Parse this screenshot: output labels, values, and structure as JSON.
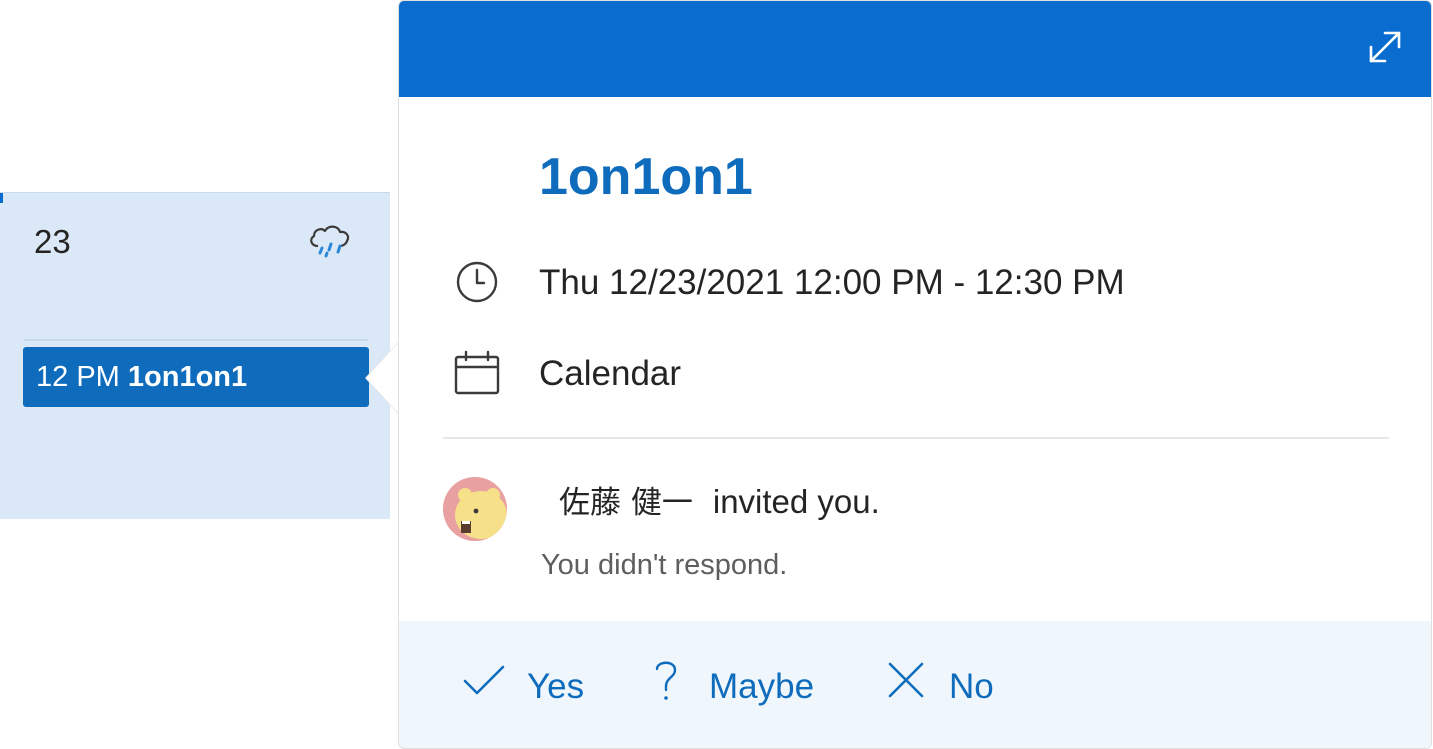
{
  "day_cell": {
    "day_number": "23",
    "weather_icon": "rain-cloud-icon",
    "event_chip": {
      "time": "12 PM",
      "title": "1on1on1"
    }
  },
  "peek": {
    "header_color": "#0b6cd0",
    "expand_icon": "expand-arrows-icon",
    "title": "1on1on1",
    "time_icon": "clock-icon",
    "time_range": "Thu 12/23/2021 12:00 PM - 12:30 PM",
    "calendar_icon": "calendar-icon",
    "calendar_name": "Calendar",
    "organizer": {
      "name": "佐藤 健一",
      "invite_text": "invited you.",
      "status": "You didn't respond."
    },
    "responses": {
      "yes": "Yes",
      "maybe": "Maybe",
      "no": "No"
    }
  },
  "colors": {
    "accent": "#0f6cbd",
    "day_cell_bg": "#dae8f7",
    "response_bar_bg": "#eff6fc"
  }
}
